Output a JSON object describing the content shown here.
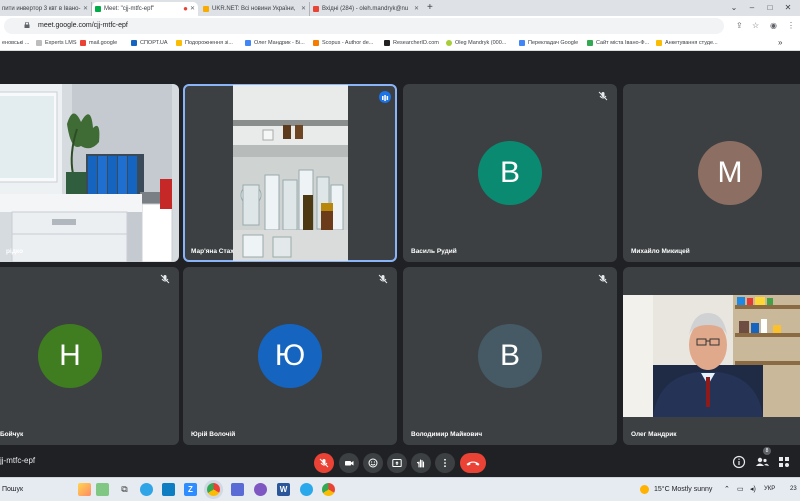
{
  "browser": {
    "tabs": [
      {
        "title": "пити инвертор 3 квт в Івано-",
        "active": false
      },
      {
        "title": "Meet: \"cjj-mtfc-epf\"",
        "active": true
      },
      {
        "title": "UKR.NET: Всі новини України, ",
        "active": false
      },
      {
        "title": "Вхідні (284) - oleh.mandryk@nu",
        "active": false
      }
    ],
    "url": "meet.google.com/cjj-mtfc-epf",
    "bookmarks": [
      "еновські ...",
      "Experts LMS",
      "mail.google",
      "СПОРТ.UA",
      "Подорожнення зі...",
      "Олег Мандрик - Бі...",
      "Scopus - Author de...",
      "ResearcherID.com",
      "Oleg Mandryk (000...",
      "Перекладач Google",
      "Сайт міста Івано-Ф...",
      "Анкетування студе..."
    ]
  },
  "meet": {
    "tiles": [
      {
        "name": "рідко",
        "type": "video"
      },
      {
        "name": "Мар'яна Стах",
        "type": "video"
      },
      {
        "name": "Василь Рудий",
        "initial": "В",
        "color": "#0b8a72"
      },
      {
        "name": "Михайло Микицей",
        "initial": "М",
        "color": "#8d6e63"
      },
      {
        "name": "Бойчук",
        "initial": "Н",
        "color": "#3f7d20"
      },
      {
        "name": "Юрій Волочій",
        "initial": "Ю",
        "color": "#1565c0"
      },
      {
        "name": "Володимир Майкович",
        "initial": "В",
        "color": "#455a64"
      },
      {
        "name": "Олег Мандрик",
        "type": "video"
      }
    ],
    "meeting_code": "jj-mtfc-epf",
    "participant_count": "8"
  },
  "taskbar": {
    "search_label": "Пошук",
    "weather": "15°C  Mostly sunny",
    "language": "УКР",
    "clock": "23"
  },
  "colors": {
    "accent": "#8ab4f8",
    "end_call": "#ea4335"
  }
}
